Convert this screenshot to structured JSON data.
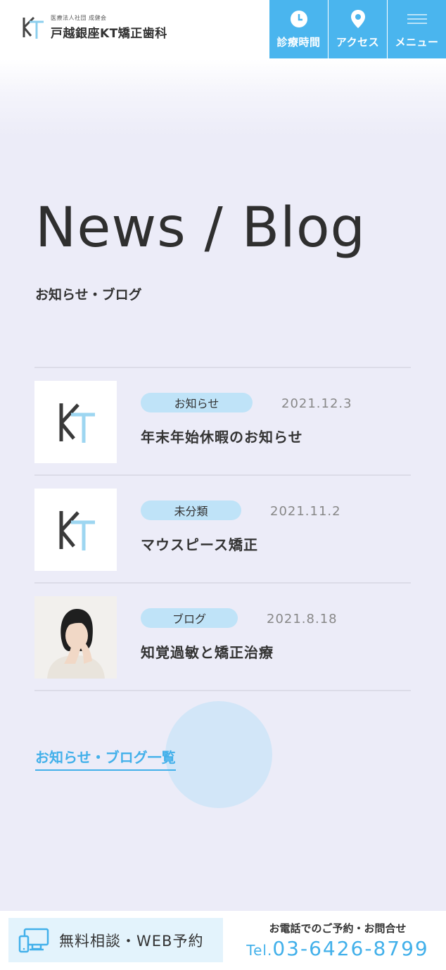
{
  "header": {
    "logo_corp": "医療法人社団 成健会",
    "logo_name": "戸越銀座KT矯正歯科",
    "buttons": [
      {
        "label": "診療時間",
        "icon": "clock-icon"
      },
      {
        "label": "アクセス",
        "icon": "map-pin-icon"
      },
      {
        "label": "メニュー",
        "icon": "menu-icon"
      }
    ]
  },
  "section": {
    "title": "News / Blog",
    "subtitle": "お知らせ・ブログ",
    "posts": [
      {
        "category": "お知らせ",
        "date": "2021.12.3",
        "title": "年末年始休暇のお知らせ",
        "thumb": "kt-logo"
      },
      {
        "category": "未分類",
        "date": "2021.11.2",
        "title": "マウスピース矯正",
        "thumb": "kt-logo"
      },
      {
        "category": "ブログ",
        "date": "2021.8.18",
        "title": "知覚過敏と矯正治療",
        "thumb": "woman-photo"
      }
    ],
    "more_link": "お知らせ・ブログ一覧"
  },
  "footer": {
    "web_label": "無料相談・WEB予約",
    "tel_caption": "お電話でのご予約・お問合せ",
    "tel_prefix": "Tel.",
    "tel_number": "03-6426-8799"
  },
  "colors": {
    "accent": "#4ab5ee",
    "section_bg": "#ececf8",
    "badge_bg": "#bfe3f8"
  }
}
